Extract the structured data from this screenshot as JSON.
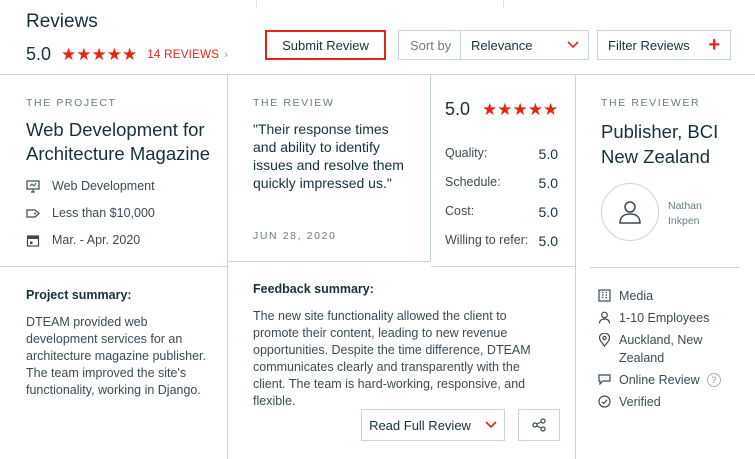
{
  "header": {
    "title": "Reviews",
    "overall_score": "5.0",
    "stars": "★★★★★",
    "reviews_count_label": "14 REVIEWS",
    "reviews_chevron": "›",
    "submit_label": "Submit Review",
    "sort_label": "Sort by",
    "sort_value": "Relevance",
    "filter_label": "Filter Reviews",
    "filter_plus": "+"
  },
  "project": {
    "eyebrow": "THE PROJECT",
    "title": "Web Development for Architecture Magazine",
    "service": "Web Development",
    "budget": "Less than $10,000",
    "dates": "Mar. - Apr. 2020",
    "summary_heading": "Project summary:",
    "summary_text": "DTEAM provided web development services for an architecture magazine publisher. The team improved the site's functionality, working in Django."
  },
  "review": {
    "eyebrow": "THE REVIEW",
    "quote": "\"Their response times and ability to identify issues and resolve them quickly impressed us.\"",
    "date": "JUN 28, 2020",
    "score": "5.0",
    "stars": "★★★★★",
    "ratings": [
      {
        "label": "Quality:",
        "value": "5.0"
      },
      {
        "label": "Schedule:",
        "value": "5.0"
      },
      {
        "label": "Cost:",
        "value": "5.0"
      },
      {
        "label": "Willing to refer:",
        "value": "5.0"
      }
    ],
    "feedback_heading": "Feedback summary:",
    "feedback_text": "The new site functionality allowed the client to promote their content, leading to new revenue opportunities. Despite the time difference, DTEAM communicates clearly and transparently with the client. The team is hard-working, responsive, and flexible.",
    "read_full_label": "Read Full Review"
  },
  "reviewer": {
    "eyebrow": "THE REVIEWER",
    "company": "Publisher, BCI New Zealand",
    "person": "Nathan Inkpen",
    "industry": "Media",
    "size": "1-10 Employees",
    "location": "Auckland, New Zealand",
    "review_type": "Online Review",
    "review_type_help": "?",
    "status": "Verified"
  },
  "colors": {
    "accent": "#e62415",
    "heading": "#17313b",
    "text": "#3b4b55",
    "muted": "#6a7b85",
    "border": "#c4d6df"
  },
  "icons": {
    "service": "monitor-icon",
    "budget": "price-tag-icon",
    "dates": "calendar-icon",
    "avatar": "user-icon",
    "industry": "building-icon",
    "size": "person-icon",
    "location": "location-pin-icon",
    "review_type": "speech-bubble-icon",
    "status": "check-circle-icon",
    "share": "share-icon"
  }
}
